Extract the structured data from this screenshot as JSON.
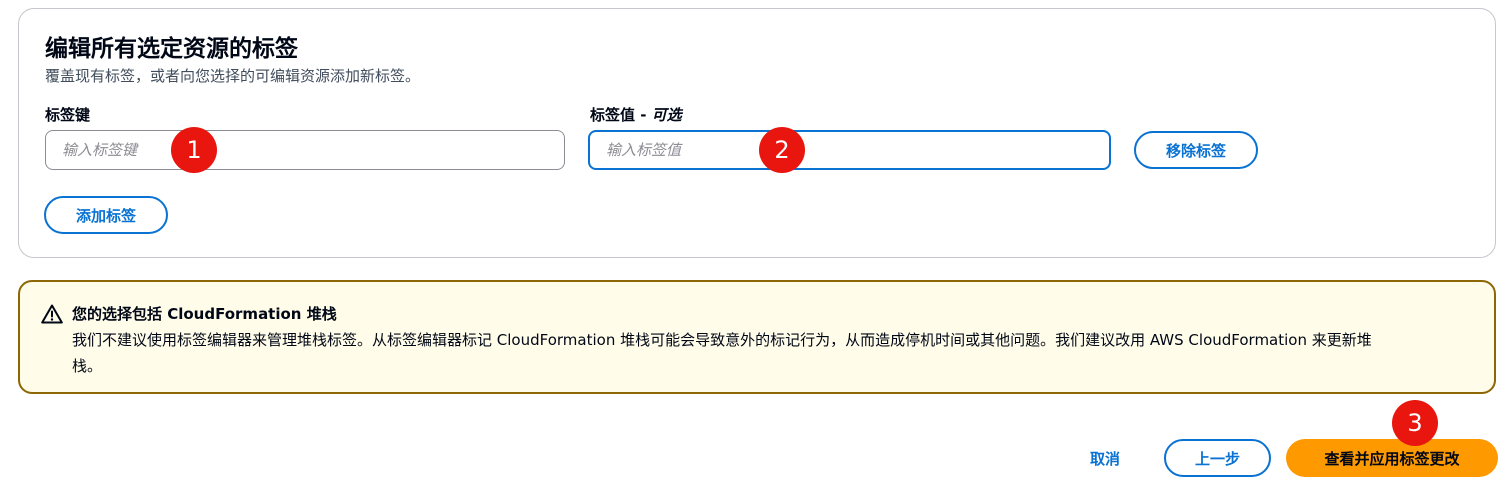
{
  "panel": {
    "title": "编辑所有选定资源的标签",
    "description": "覆盖现有标签，或者向您选择的可编辑资源添加新标签。",
    "tag_key_label": "标签键",
    "tag_value_label": "标签值 - ",
    "tag_value_optional": "可选",
    "tag_key_placeholder": "输入标签键",
    "tag_value_placeholder": "输入标签值",
    "remove_tag_label": "移除标签",
    "add_tag_label": "添加标签"
  },
  "alert": {
    "icon": "warning-icon",
    "title": "您的选择包括 CloudFormation 堆栈",
    "body": "我们不建议使用标签编辑器来管理堆栈标签。从标签编辑器标记 CloudFormation 堆栈可能会导致意外的标记行为，从而造成停机时间或其他问题。我们建议改用 AWS CloudFormation 来更新堆栈。"
  },
  "footer": {
    "cancel_label": "取消",
    "previous_label": "上一步",
    "apply_label": "查看并应用标签更改"
  },
  "markers": [
    "1",
    "2",
    "3"
  ],
  "colors": {
    "accent": "#0972d3",
    "primary_button": "#ff9900",
    "warning_border": "#8d6605",
    "warning_background": "#fffce9",
    "marker": "#e8160e"
  }
}
